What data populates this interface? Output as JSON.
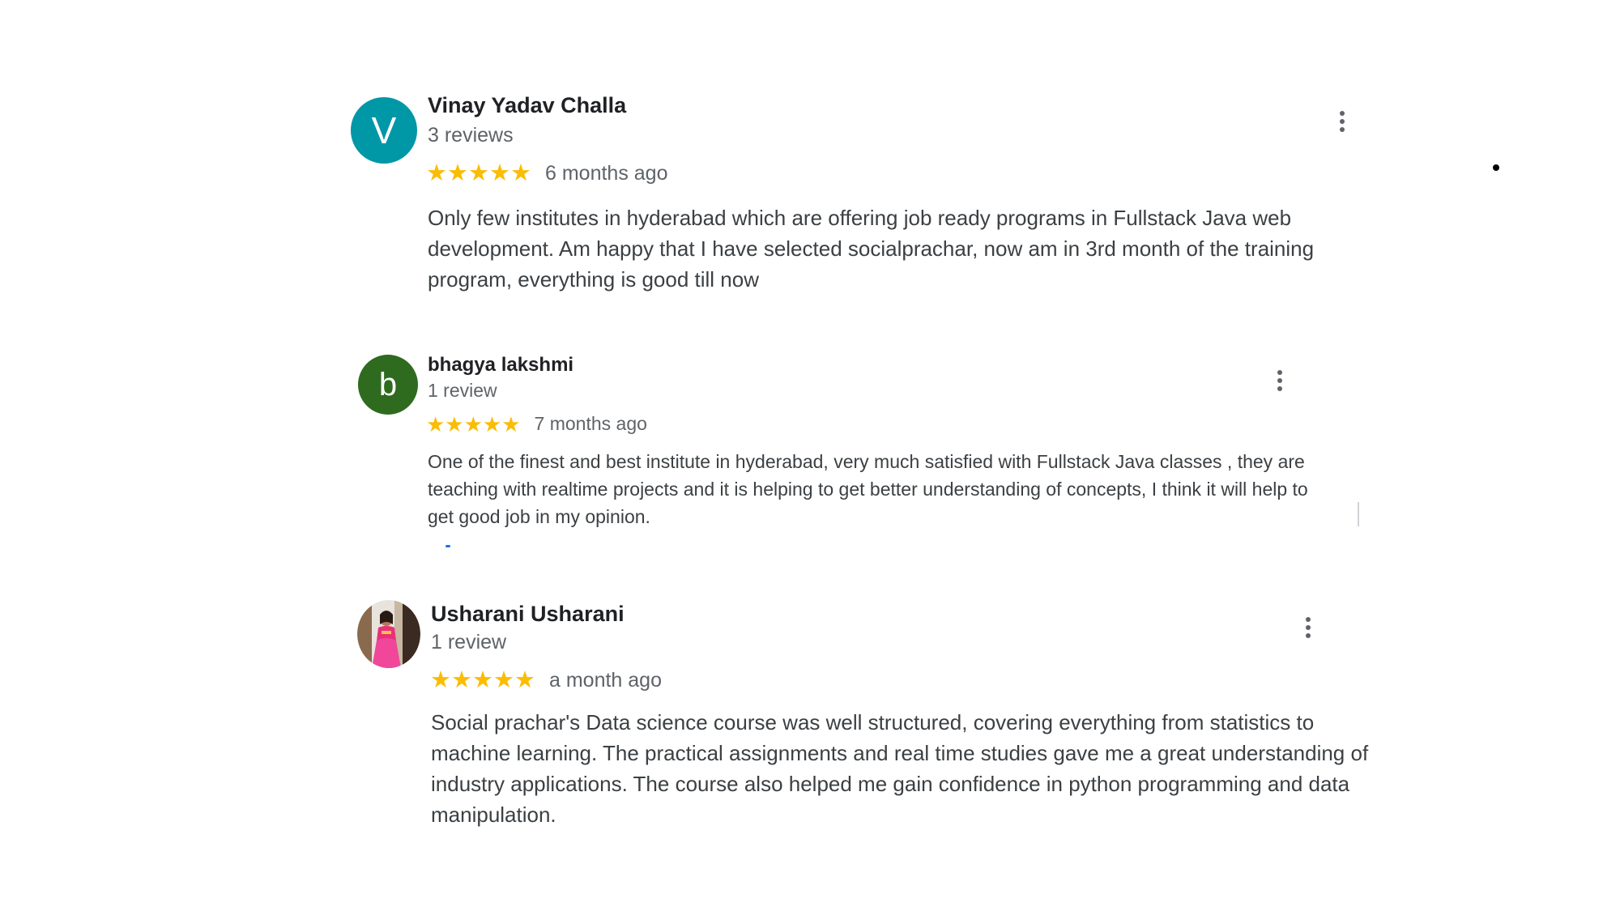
{
  "colors": {
    "star": "#fbbc04",
    "avatar_v": "#0097a7",
    "avatar_b": "#2e6b1f",
    "secondary_text": "#5f6368"
  },
  "reviews": [
    {
      "avatar_letter": "V",
      "avatar_icon": "letter-avatar",
      "name": "Vinay Yadav Challa",
      "review_count": "3 reviews",
      "stars": "★★★★★",
      "rating": 5,
      "time": "6 months ago",
      "text": "Only few institutes in hyderabad which are offering job ready programs in Fullstack Java web development. Am happy that I have selected socialprachar, now am in 3rd month of the training program, everything is good till now",
      "menu_icon": "more-vert-icon"
    },
    {
      "avatar_letter": "b",
      "avatar_icon": "letter-avatar",
      "name": "bhagya lakshmi",
      "review_count": "1 review",
      "stars": "★★★★★",
      "rating": 5,
      "time": "7 months ago",
      "text": "One of the finest and best institute in hyderabad, very much satisfied with Fullstack Java classes , they are teaching with realtime projects and it is helping to get better understanding of concepts, I think it will help to get good job in my opinion.",
      "menu_icon": "more-vert-icon"
    },
    {
      "avatar_icon": "profile-photo-avatar",
      "name": "Usharani Usharani",
      "review_count": "1 review",
      "stars": "★★★★★",
      "rating": 5,
      "time": "a month ago",
      "text": "Social prachar's Data science course was well structured, covering everything from statistics to machine learning. The practical assignments and real time studies gave me a great understanding of industry applications. The course also helped me gain confidence in python programming and data manipulation.",
      "menu_icon": "more-vert-icon"
    }
  ]
}
